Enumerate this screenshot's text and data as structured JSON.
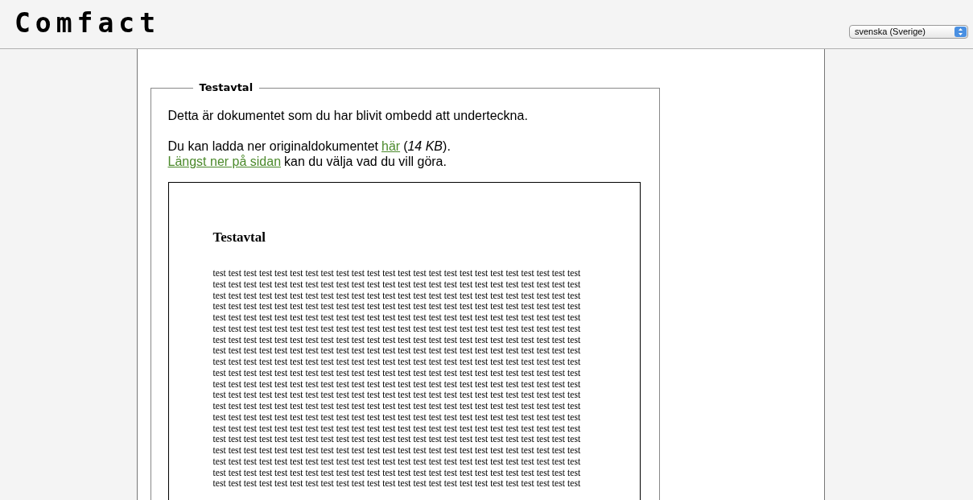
{
  "header": {
    "logo": "Comfact",
    "language_select": {
      "value": "svenska (Sverige)"
    }
  },
  "panel": {
    "legend": "Testavtal",
    "intro": "Detta är dokumentet som du har blivit ombedd att underteckna.",
    "download": {
      "before": "Du kan ladda ner originaldokumentet",
      "link": "här",
      "after_open": "(",
      "size": "14 KB",
      "after_close": ")."
    },
    "bottom": {
      "link": "Längst ner på sidan",
      "after": "kan du välja vad du vill göra."
    },
    "document": {
      "title": "Testavtal",
      "body": "test test test test test test test test test test test test test test test test test test test test test test test test test test test test test test test test test test test test test test test test test test test test test test test test test test test test test test test test test test test test test test test test test test test test test test test test test test test test test test test test test test test test test test test test test test test test test test test test test test test test test test test test test test test test test test test test test test test test test test test test test test test test test test test test test test test test test test test test test test test test test test test test test test test test test test test test test test test test test test test test test test test test test test test test test test test test test test test test test test test test test test test test test test test test test test test test test test test test test test test test test test test test test test test test test test test test test test test test test test test test test test test test test test test test test test test test test test test test test test test test test test test test test test test test test test test test test test test test test test test test test test test test test test test test test test test test test test test test test test test test test test test test test test test test test test test test test test test test test test test test test test test test test test test test test test test test test test test test test test test test test test test test test test test test test test test test test test test test test test test test test test test test test test test test test test test test test test test test test test test test test test test test test test test test test test test test test test test test test test test test test test test test test test test test test test test test test test test test test test test test test test test test test test test test test test test test test test test test test test test test test test test test test test test test test test test test test test test test test test test test test test test test test test test test test test test test test test test test test test test test test test test test test test test test test test test test test test test test test test test test"
    }
  }
}
